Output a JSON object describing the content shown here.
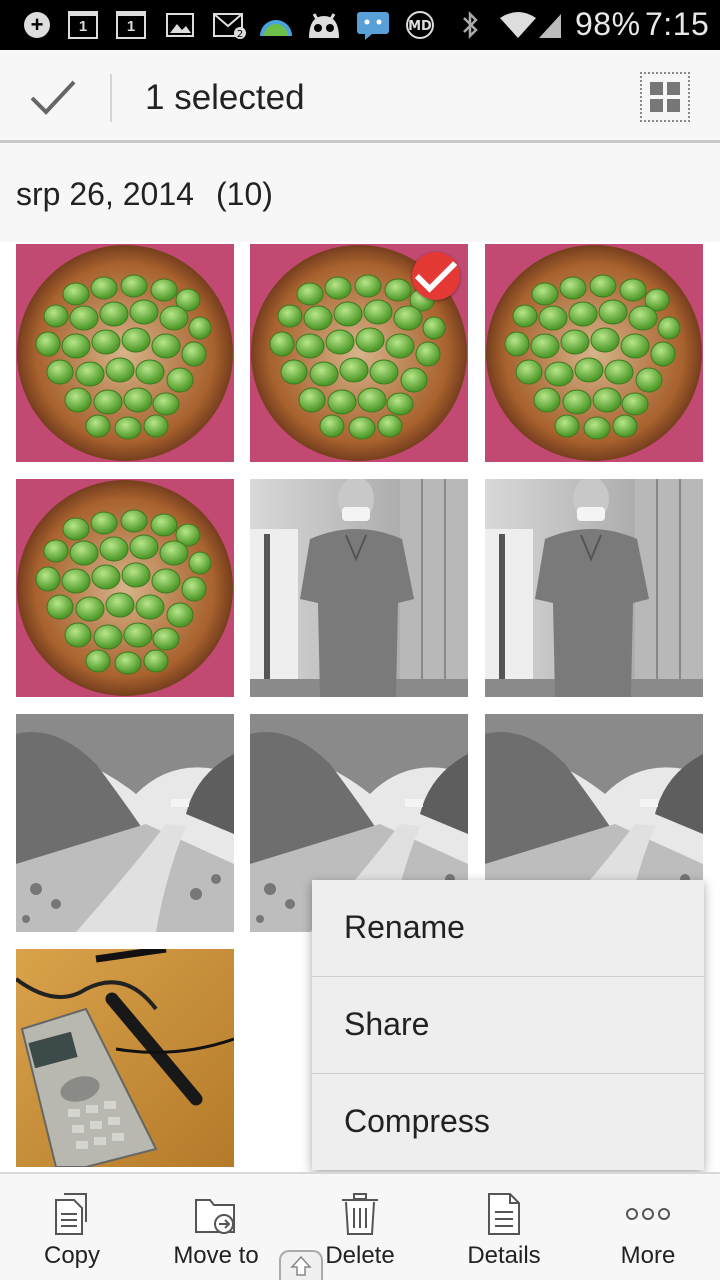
{
  "status_bar": {
    "battery": "98%",
    "time": "7:15",
    "calendar_day_1": "1",
    "calendar_day_2": "1",
    "icons": [
      "plus-icon",
      "calendar-icon",
      "calendar-icon",
      "image-icon",
      "gmail-icon",
      "weather-icon",
      "android-icon",
      "message-icon",
      "md-icon",
      "bluetooth-icon",
      "wifi-icon",
      "signal-icon",
      "battery-icon"
    ]
  },
  "action_bar": {
    "title": "1 selected"
  },
  "date_group": {
    "date": "srp 26, 2014",
    "count": "(10)"
  },
  "photos": [
    {
      "kind": "tart",
      "selected": false
    },
    {
      "kind": "tart",
      "selected": true
    },
    {
      "kind": "tart",
      "selected": false
    },
    {
      "kind": "tart",
      "selected": false
    },
    {
      "kind": "person",
      "selected": false
    },
    {
      "kind": "person",
      "selected": false
    },
    {
      "kind": "path",
      "selected": false
    },
    {
      "kind": "path",
      "selected": false
    },
    {
      "kind": "path",
      "selected": false
    },
    {
      "kind": "phone",
      "selected": false
    }
  ],
  "menu": {
    "items": [
      "Rename",
      "Share",
      "Compress"
    ]
  },
  "toolbar": {
    "items": [
      "Copy",
      "Move to",
      "Delete",
      "Details",
      "More"
    ]
  },
  "colors": {
    "selected_badge": "#e53935",
    "background": "#f7f7f7"
  }
}
